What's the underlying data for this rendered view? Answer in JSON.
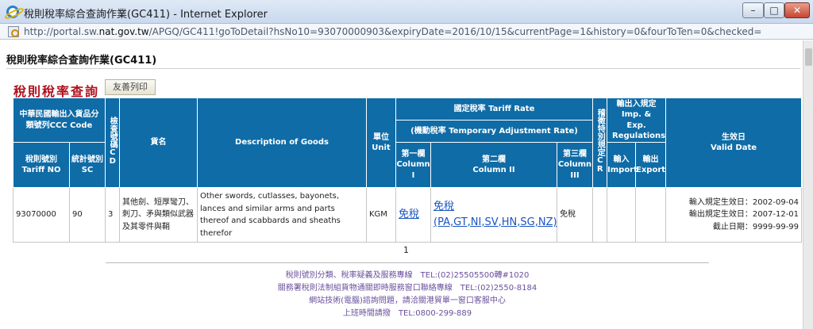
{
  "window": {
    "title": "稅則稅率綜合查詢作業(GC411) - Internet Explorer",
    "controls": {
      "minimize": "–",
      "maximize": "□",
      "close": "✕"
    }
  },
  "address": {
    "url_prefix": "http://portal.sw.",
    "url_host": "nat.gov.tw",
    "url_rest": "/APGQ/GC411!goToDetail?hsNo10=93070000903&expiryDate=2016/10/15&currentPage=1&history=0&fourToTen=0&checked="
  },
  "page": {
    "heading": "稅則稅率綜合查詢作業(GC411)",
    "section_title": "稅則稅率查詢",
    "print_button": "友善列印"
  },
  "table": {
    "headers": {
      "ccc_code": "中華民國輸出入貨品分類號列CCC Code",
      "check_code": "檢查號碼CD",
      "goods_name": "貨名",
      "description": "Description of Goods",
      "unit_zh": "單位",
      "unit_en": "Unit",
      "tariff_rate": "國定稅率 Tariff Rate",
      "temp_rate": "(機動稅率 Temporary Adjustment Rate)",
      "col1_zh": "第一欄",
      "col1_en": "Column I",
      "col2_zh": "第二欄",
      "col2_en": "Column II",
      "col3_zh": "第三欄",
      "col3_en": "Column III",
      "special_rule": "稽徵特別規定CR",
      "regulations": "輸出入規定 Imp. & Exp. Regulations",
      "import_zh": "輸入",
      "import_en": "Import",
      "export_zh": "輸出",
      "export_en": "Export",
      "valid_zh": "生效日",
      "valid_en": "Valid Date",
      "tariff_no_zh": "稅則號別",
      "tariff_no_en": "Tariff NO",
      "sc_zh": "統計號別",
      "sc_en": "SC"
    },
    "row": {
      "tariff_no": "93070000",
      "sc": "90",
      "cd": "3",
      "goods_name": "其他劍、短厚彎刀、刺刀、矛與類似武器及其零件與鞘",
      "description": "Other swords, cutlasses, bayonets, lances and similar arms and parts thereof and scabbards and sheaths therefor",
      "unit": "KGM",
      "col1": "免稅",
      "col2_main": "免稅",
      "col2_sub": "(PA,GT,NI,SV,HN,SG,NZ)",
      "col3": "免稅",
      "cr": "",
      "import": "",
      "export": "",
      "valid_import": "輸入規定生效日：2002-09-04",
      "valid_export": "輸出規定生效日：2007-12-01",
      "valid_expiry": "截止日期：9999-99-99"
    }
  },
  "pager": {
    "current_page": "1"
  },
  "footer": {
    "line1": "稅則號別分類、稅率疑義及服務專線　TEL:(02)25505500轉#1020",
    "line2": "關務署稅則法制組貨物通關即時服務窗口聯絡專線　TEL:(02)2550-8184",
    "line3": "網站技術(電腦)諮詢問題，請洽關港貿單一窗口客服中心",
    "line4": "上班時間請撥　TEL:0800-299-889"
  }
}
